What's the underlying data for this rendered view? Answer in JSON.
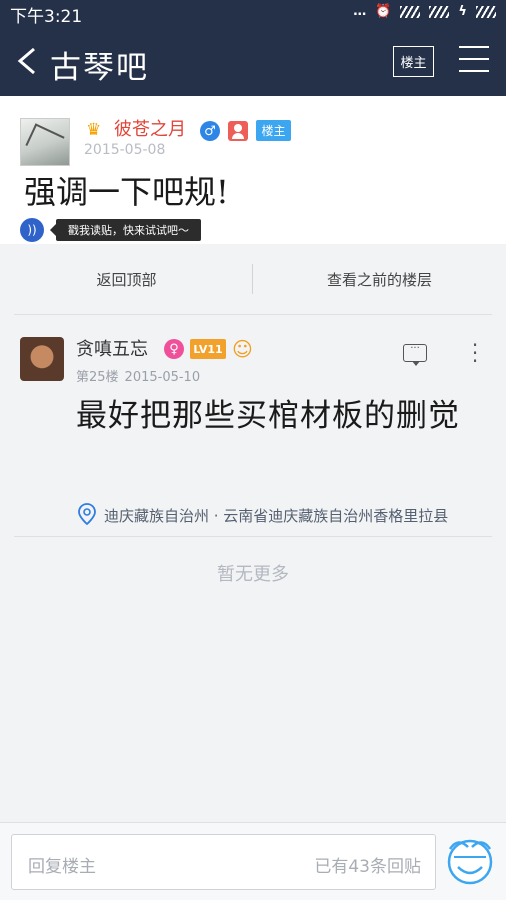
{
  "status_bar": {
    "time": "下午3:21",
    "indicators": [
      "...",
      "⏰",
      "≋",
      "////",
      "ϟ"
    ]
  },
  "nav": {
    "title": "古琴吧",
    "owner_only_label": "楼主"
  },
  "main_post": {
    "author": "彼苍之月",
    "owner_badge": "楼主",
    "date": "2015-05-08",
    "title": "强调一下吧规!",
    "audio_tip": "戳我读贴，快来试试吧～"
  },
  "actions": {
    "back_top": "返回顶部",
    "prev_floors": "查看之前的楼层"
  },
  "reply": {
    "author": "贪嗔五忘",
    "level": "LV11",
    "floor": "第25楼",
    "date": "2015-05-10",
    "text": "最好把那些买棺材板的删觉",
    "location": "迪庆藏族自治州 · 云南省迪庆藏族自治州香格里拉县"
  },
  "no_more": "暂无更多",
  "input": {
    "placeholder": "回复楼主",
    "count": "已有43条回贴"
  },
  "colors": {
    "nav_bg": "#253049",
    "author_red": "#e0463a",
    "owner_blue": "#3da6f0",
    "level_orange": "#f2a12c"
  },
  "icons": [
    "back-icon",
    "menu-icon",
    "crown-icon",
    "male-icon",
    "user-icon",
    "audio-icon",
    "female-icon",
    "emoji-icon",
    "comment-icon",
    "more-icon",
    "location-icon",
    "face-icon"
  ]
}
